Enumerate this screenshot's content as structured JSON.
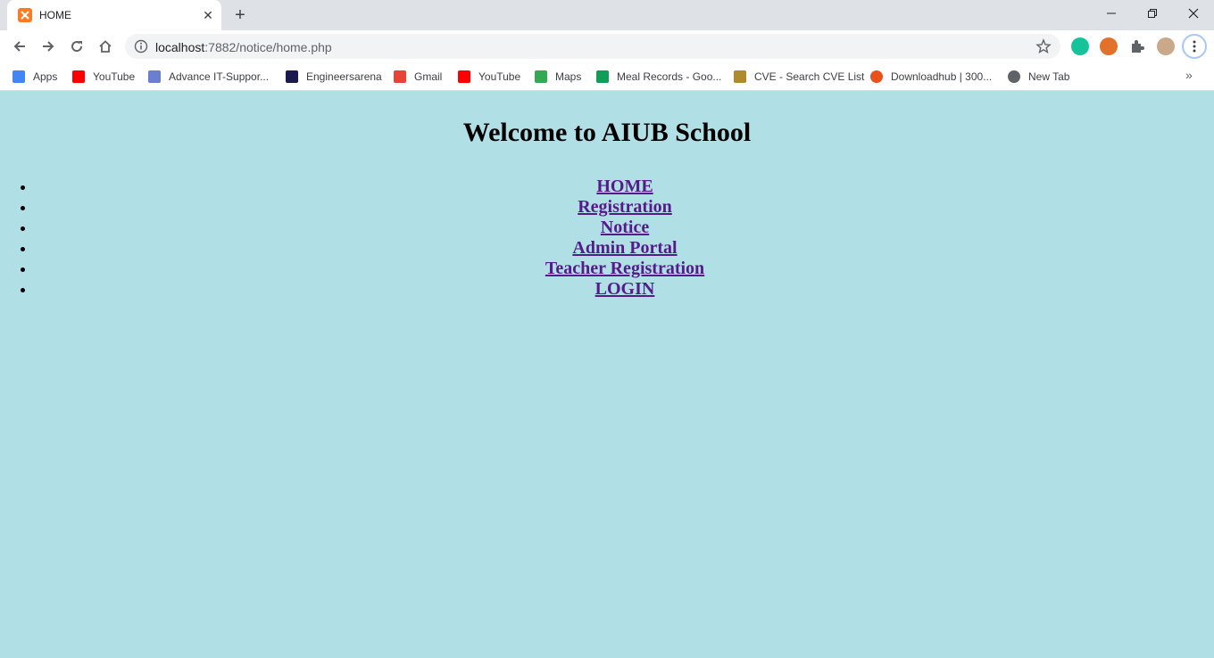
{
  "browser": {
    "tab_title": "HOME",
    "url_host": "localhost",
    "url_rest": ":7882/notice/home.php",
    "bookmarks": [
      {
        "label": "Apps",
        "icon": "apps-grid-icon",
        "color": "#4285f4"
      },
      {
        "label": "YouTube",
        "icon": "youtube-icon",
        "color": "#ff0000"
      },
      {
        "label": "Advance IT-Suppor...",
        "icon": "advance-it-icon",
        "color": "#6a7fd0"
      },
      {
        "label": "Engineersarena",
        "icon": "hd-icon",
        "color": "#1a1a4e"
      },
      {
        "label": "Gmail",
        "icon": "gmail-icon",
        "color": "#ea4335"
      },
      {
        "label": "YouTube",
        "icon": "youtube-icon",
        "color": "#ff0000"
      },
      {
        "label": "Maps",
        "icon": "maps-pin-icon",
        "color": "#34a853"
      },
      {
        "label": "Meal Records - Goo...",
        "icon": "sheets-icon",
        "color": "#0f9d58"
      },
      {
        "label": "CVE - Search CVE List",
        "icon": "cve-icon",
        "color": "#b08a2e"
      },
      {
        "label": "Downloadhub | 300...",
        "icon": "downloadhub-icon",
        "color": "#e8501c"
      },
      {
        "label": "New Tab",
        "icon": "globe-icon",
        "color": "#5f6368"
      }
    ],
    "bookmarks_more": "»"
  },
  "page": {
    "title": "Welcome to AIUB School",
    "nav": [
      "HOME",
      "Registration",
      "Notice",
      "Admin Portal",
      "Teacher Registration",
      "LOGIN"
    ]
  },
  "colors": {
    "page_background": "#b0dfe5",
    "link_visited": "#551a8b"
  }
}
